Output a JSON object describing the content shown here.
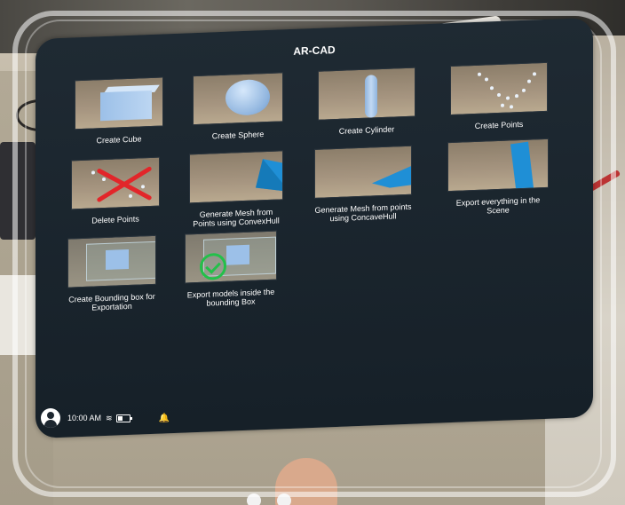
{
  "panel": {
    "title": "AR-CAD",
    "tiles": [
      {
        "label": "Create Cube",
        "icon": "cube-icon"
      },
      {
        "label": "Create Sphere",
        "icon": "sphere-icon"
      },
      {
        "label": "Create Cylinder",
        "icon": "cylinder-icon"
      },
      {
        "label": "Create Points",
        "icon": "points-icon"
      },
      {
        "label": "Delete Points",
        "icon": "delete-points-icon"
      },
      {
        "label": "Generate Mesh from Points using ConvexHull",
        "icon": "convex-mesh-icon"
      },
      {
        "label": "Generate Mesh from points using ConcaveHull",
        "icon": "concave-mesh-icon"
      },
      {
        "label": "Export everything in the Scene",
        "icon": "export-scene-icon"
      },
      {
        "label": "Create Bounding box for Exportation",
        "icon": "bounding-box-icon"
      },
      {
        "label": "Export models inside the bounding Box",
        "icon": "export-bbox-icon"
      }
    ]
  },
  "status": {
    "time": "10:00 AM",
    "icons": [
      "avatar-icon",
      "wifi-icon",
      "battery-icon",
      "bell-icon"
    ]
  },
  "colors": {
    "panel_bg": "#1b252e",
    "text": "#ffffff",
    "accent_red": "#e2262a",
    "accent_green": "#23c04a"
  }
}
